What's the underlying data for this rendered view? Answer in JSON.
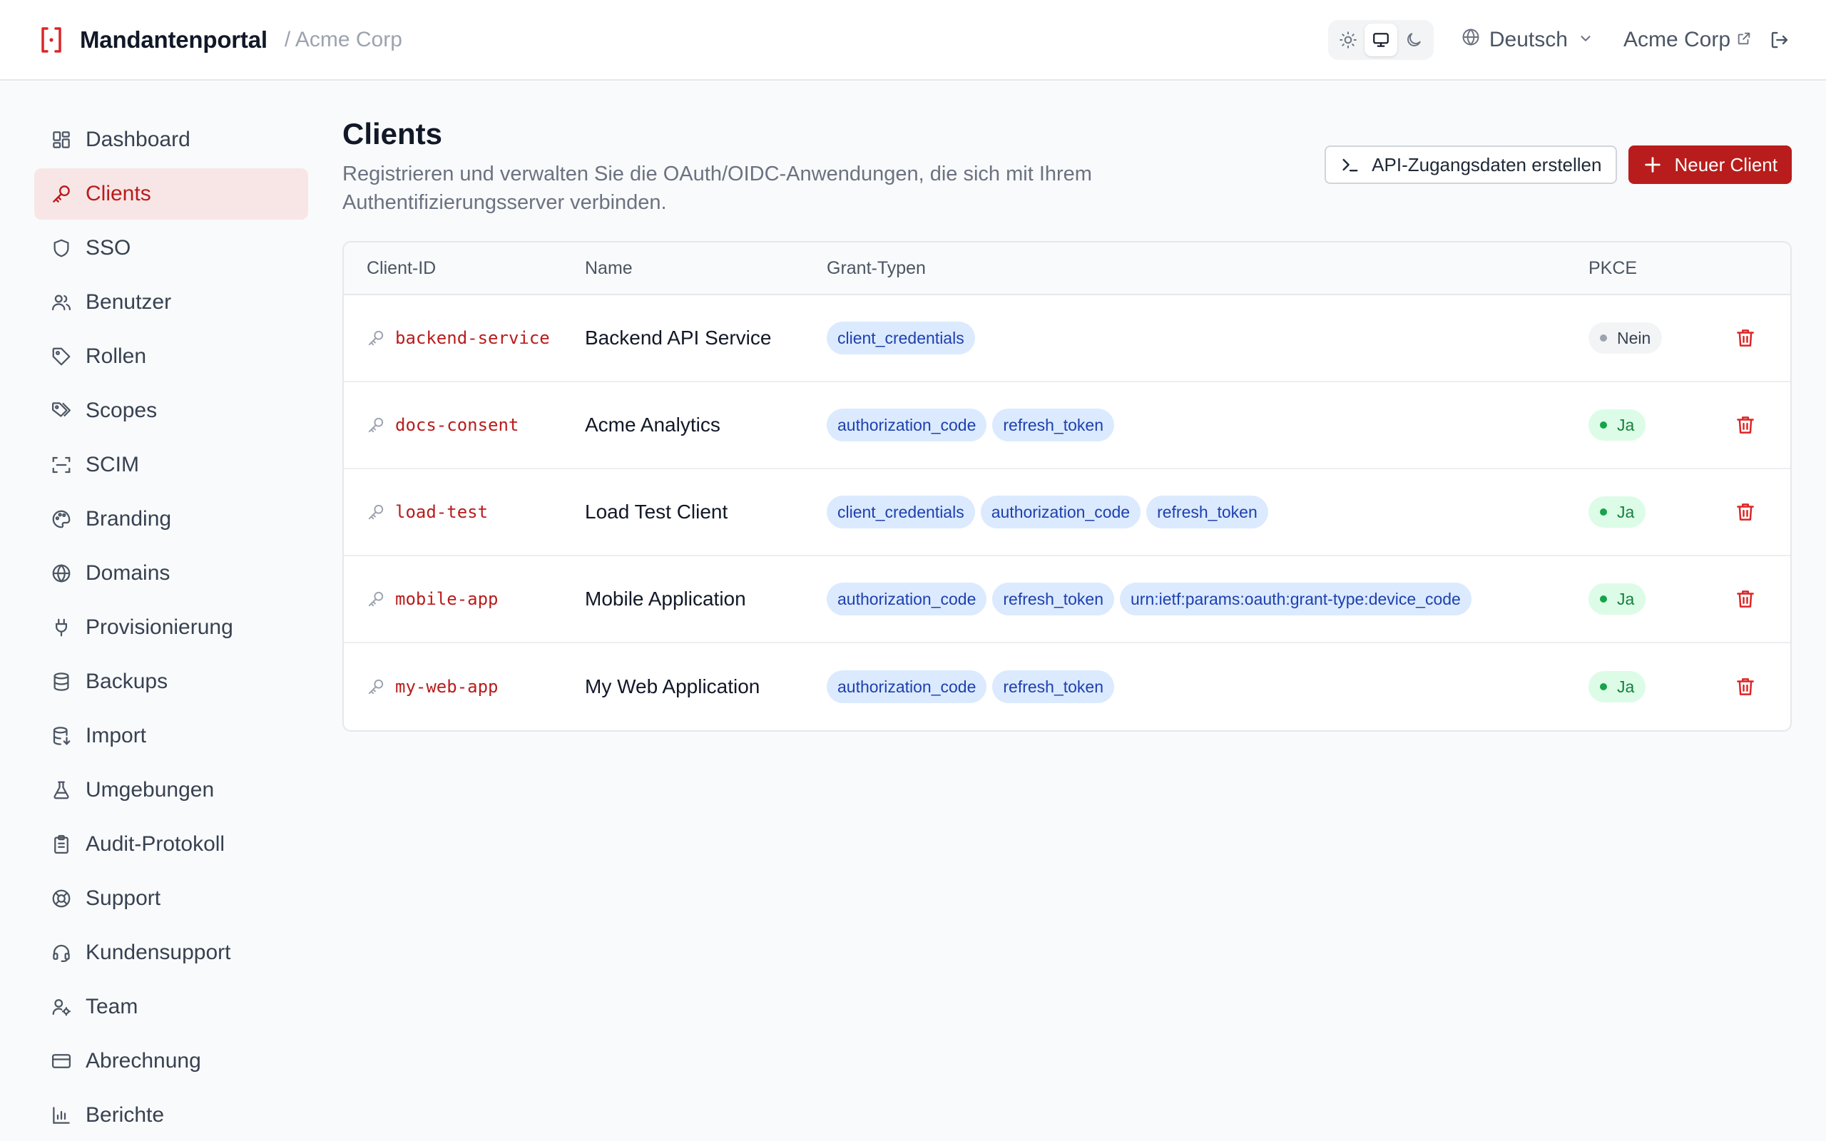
{
  "header": {
    "app_name": "Mandantenportal",
    "tenant_breadcrumb": "/ Acme Corp",
    "language": "Deutsch",
    "tenant_link": "Acme Corp",
    "icons": [
      "portal-logo-icon",
      "sun-icon",
      "monitor-icon",
      "moon-icon",
      "globe-icon",
      "chevron-down-icon",
      "external-link-icon",
      "logout-icon"
    ]
  },
  "sidebar": {
    "items": [
      {
        "label": "Dashboard",
        "icon": "dashboard-icon"
      },
      {
        "label": "Clients",
        "icon": "key-icon",
        "active": true
      },
      {
        "label": "SSO",
        "icon": "shield-icon"
      },
      {
        "label": "Benutzer",
        "icon": "users-icon"
      },
      {
        "label": "Rollen",
        "icon": "tag-icon"
      },
      {
        "label": "Scopes",
        "icon": "tags-icon"
      },
      {
        "label": "SCIM",
        "icon": "scan-icon"
      },
      {
        "label": "Branding",
        "icon": "palette-icon"
      },
      {
        "label": "Domains",
        "icon": "globe-icon"
      },
      {
        "label": "Provisionierung",
        "icon": "plug-icon"
      },
      {
        "label": "Backups",
        "icon": "database-icon"
      },
      {
        "label": "Import",
        "icon": "database-import-icon"
      },
      {
        "label": "Umgebungen",
        "icon": "flask-icon"
      },
      {
        "label": "Audit-Protokoll",
        "icon": "clipboard-icon"
      },
      {
        "label": "Support",
        "icon": "lifebuoy-icon"
      },
      {
        "label": "Kundensupport",
        "icon": "headset-icon"
      },
      {
        "label": "Team",
        "icon": "user-cog-icon"
      },
      {
        "label": "Abrechnung",
        "icon": "credit-card-icon"
      },
      {
        "label": "Berichte",
        "icon": "bar-chart-icon"
      }
    ]
  },
  "page": {
    "title": "Clients",
    "subtitle": "Registrieren und verwalten Sie die OAuth/OIDC-Anwendungen, die sich mit Ihrem Authentifizierungsserver verbinden.",
    "btn_api": "API-Zugangsdaten erstellen",
    "btn_new": "Neuer Client"
  },
  "table": {
    "columns": {
      "client_id": "Client-ID",
      "name": "Name",
      "grants": "Grant-Typen",
      "pkce": "PKCE"
    },
    "rows": [
      {
        "client_id": "backend-service",
        "name": "Backend API Service",
        "grants": [
          "client_credentials"
        ],
        "pkce": "Nein",
        "pkce_enabled": false
      },
      {
        "client_id": "docs-consent",
        "name": "Acme Analytics",
        "grants": [
          "authorization_code",
          "refresh_token"
        ],
        "pkce": "Ja",
        "pkce_enabled": true
      },
      {
        "client_id": "load-test",
        "name": "Load Test Client",
        "grants": [
          "client_credentials",
          "authorization_code",
          "refresh_token"
        ],
        "pkce": "Ja",
        "pkce_enabled": true
      },
      {
        "client_id": "mobile-app",
        "name": "Mobile Application",
        "grants": [
          "authorization_code",
          "refresh_token",
          "urn:ietf:params:oauth:grant-type:device_code"
        ],
        "pkce": "Ja",
        "pkce_enabled": true
      },
      {
        "client_id": "my-web-app",
        "name": "My Web Application",
        "grants": [
          "authorization_code",
          "refresh_token"
        ],
        "pkce": "Ja",
        "pkce_enabled": true
      }
    ]
  },
  "colors": {
    "accent": "#b91c1c",
    "active_bg": "#f8e6e6",
    "badge_bg": "#dbeafe",
    "badge_text": "#1e40af",
    "pkce_yes": "#16a34a"
  }
}
